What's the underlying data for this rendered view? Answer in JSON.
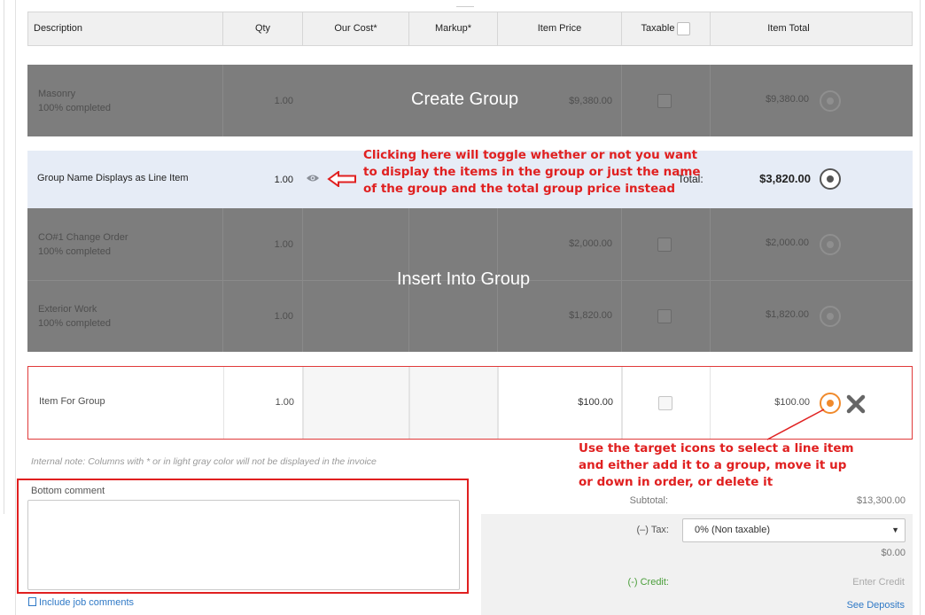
{
  "table": {
    "headers": {
      "description": "Description",
      "qty": "Qty",
      "our_cost": "Our Cost*",
      "markup": "Markup*",
      "item_price": "Item Price",
      "taxable": "Taxable",
      "item_total": "Item Total"
    },
    "rows": [
      {
        "description": "Masonry",
        "status": "100% completed",
        "qty": "1.00",
        "item_price": "$9,380.00",
        "item_total": "$9,380.00"
      },
      {
        "description": "CO#1 Change Order",
        "status": "100% completed",
        "qty": "1.00",
        "item_price": "$2,000.00",
        "item_total": "$2,000.00"
      },
      {
        "description": "Exterior Work",
        "status": "100% completed",
        "qty": "1.00",
        "item_price": "$1,820.00",
        "item_total": "$1,820.00"
      }
    ],
    "group": {
      "name": "Group Name Displays as Line Item",
      "qty": "1.00",
      "total_label": "Total:",
      "total": "$3,820.00"
    },
    "selected_item": {
      "description": "Item For Group",
      "qty": "1.00",
      "item_price": "$100.00",
      "item_total": "$100.00"
    }
  },
  "overlays": {
    "create_group": "Create Group",
    "insert_into_group": "Insert Into Group"
  },
  "annotations": {
    "toggle": [
      "Clicking here will toggle whether or not you want",
      "to display the items in the group or just the name",
      "of the group and the total group price instead"
    ],
    "target": [
      "Use the target icons to select a line item",
      "and either add it to a group, move it up",
      "or down in order, or delete it"
    ]
  },
  "internal_note": "Internal note: Columns with * or in light gray color will not be displayed in the invoice",
  "bottom_comment": {
    "label": "Bottom comment",
    "value": ""
  },
  "include_job_comments": "Include job comments",
  "summary": {
    "subtotal_label": "Subtotal:",
    "subtotal": "$13,300.00",
    "tax_label": "(–) Tax:",
    "tax_selected": "0% (Non taxable)",
    "tax_amount": "$0.00",
    "credit_label": "(-) Credit:",
    "credit_placeholder": "Enter Credit",
    "see_deposits": "See Deposits"
  },
  "colors": {
    "annotation_red": "#e02020",
    "overlay_grey": "#7d7d7d",
    "group_row_bg": "#e6ecf6",
    "target_orange": "#f08a2c",
    "link_blue": "#2f79c6",
    "credit_green": "#4a9e3a"
  }
}
